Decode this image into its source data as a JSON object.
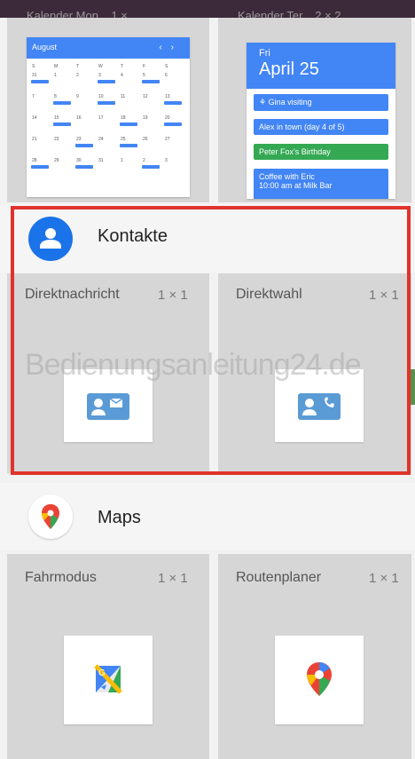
{
  "top_labels": {
    "left": "Kalender   Mon...   1 × ...",
    "right": "Kalender   Ter...   2 × 2"
  },
  "calendar_month": {
    "month": "August",
    "nav_prev": "‹",
    "nav_next": "›",
    "weekdays": [
      "S",
      "M",
      "T",
      "W",
      "T",
      "F",
      "S"
    ],
    "days": [
      "31",
      "1",
      "2",
      "3",
      "4",
      "5",
      "6",
      "7",
      "8",
      "9",
      "10",
      "11",
      "12",
      "13",
      "14",
      "15",
      "16",
      "17",
      "18",
      "19",
      "20",
      "21",
      "22",
      "23",
      "24",
      "25",
      "26",
      "27",
      "28",
      "29",
      "30",
      "31",
      "1",
      "2",
      "3"
    ]
  },
  "calendar_day": {
    "weekday": "Fri",
    "date": "April 25",
    "events": [
      {
        "label": "⚘ Gina visiting",
        "color": "#4285f4"
      },
      {
        "label": "Alex in town (day 4 of 5)",
        "color": "#4285f4"
      },
      {
        "label": "Peter Fox's Birthday",
        "color": "#34a853"
      },
      {
        "label": "Coffee with Eric",
        "sub": "10:00 am at Milk Bar",
        "color": "#4285f4"
      }
    ]
  },
  "contacts": {
    "title": "Kontakte",
    "widgets": [
      {
        "label": "Direktnachricht",
        "size": "1 × 1"
      },
      {
        "label": "Direktwahl",
        "size": "1 × 1"
      }
    ]
  },
  "maps": {
    "title": "Maps",
    "widgets": [
      {
        "label": "Fahrmodus",
        "size": "1 × 1"
      },
      {
        "label": "Routenplaner",
        "size": "1 × 1"
      }
    ]
  },
  "watermark": "Bedienungsanleitung24.de",
  "colors": {
    "highlight": "#e0332b",
    "google_blue": "#4285f4",
    "tile_bg": "#d6d6d6"
  }
}
